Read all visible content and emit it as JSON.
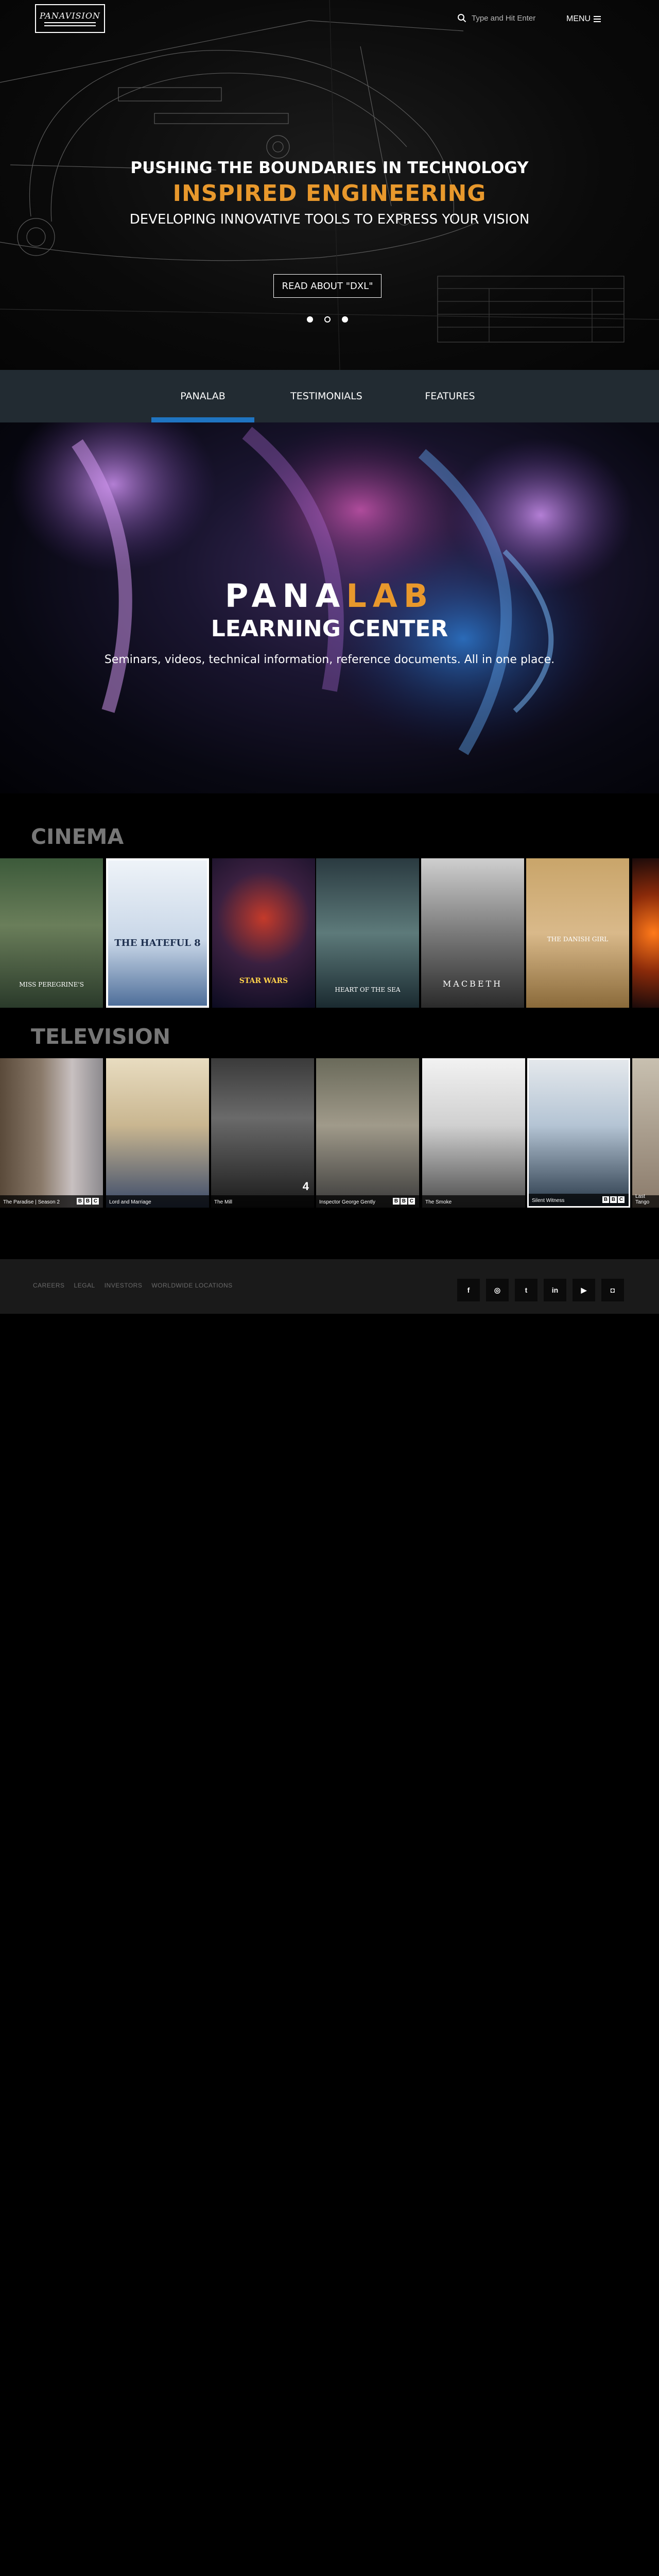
{
  "header": {
    "logo_text": "PANAVISION",
    "search": {
      "placeholder": "Type and Hit Enter",
      "icon": "search-icon"
    },
    "menu_label": "MENU",
    "menu_icon": "hamburger-icon"
  },
  "hero": {
    "kicker": "PUSHING THE BOUNDARIES IN TECHNOLOGY",
    "title": "INSPIRED ENGINEERING",
    "subtitle": "DEVELOPING INNOVATIVE TOOLS TO EXPRESS YOUR VISION",
    "cta": "READ ABOUT \"DXL\"",
    "slides": 3,
    "active_slide": 2
  },
  "tabs": {
    "items": [
      {
        "label": "PANALAB",
        "active": true
      },
      {
        "label": "TESTIMONIALS",
        "active": false
      },
      {
        "label": "FEATURES",
        "active": false
      }
    ]
  },
  "banner": {
    "brand_a": "PANA",
    "brand_b": "LAB",
    "title": "LEARNING CENTER",
    "description": "Seminars, videos, technical information, reference documents. All in one place."
  },
  "cinema": {
    "heading": "CINEMA",
    "posters": [
      {
        "title": "Miss Peregrine's Home for Peculiar Children",
        "poster_text": "MISS PEREGRINE'S"
      },
      {
        "title": "The Hateful 8",
        "poster_text": "THE HATEFUL 8"
      },
      {
        "title": "Star Wars: The Force Awakens",
        "poster_text": "STAR WARS"
      },
      {
        "title": "In the Heart of the Sea",
        "poster_text": "HEART OF THE SEA"
      },
      {
        "title": "Macbeth",
        "poster_text": "MACBETH"
      },
      {
        "title": "The Danish Girl",
        "poster_text": "THE DANISH GIRL"
      },
      {
        "title": "",
        "poster_text": ""
      }
    ]
  },
  "television": {
    "heading": "TELEVISION",
    "shows": [
      {
        "title": "The Paradise | Season 2",
        "network": "BBC"
      },
      {
        "title": "Lord and Marriage",
        "network": ""
      },
      {
        "title": "The Mill",
        "network": "4"
      },
      {
        "title": "Inspector George Gently",
        "network": "BBC"
      },
      {
        "title": "The Smoke",
        "network": ""
      },
      {
        "title": "Silent Witness",
        "network": "BBC"
      },
      {
        "title": "Last Tango",
        "network": ""
      }
    ]
  },
  "footer": {
    "links": [
      "CAREERS",
      "LEGAL",
      "INVESTORS",
      "WORLDWIDE LOCATIONS"
    ],
    "socials": [
      {
        "icon": "facebook-icon",
        "glyph": "f"
      },
      {
        "icon": "instagram-icon",
        "glyph": "◎"
      },
      {
        "icon": "twitter-icon",
        "glyph": "t"
      },
      {
        "icon": "linkedin-icon",
        "glyph": "in"
      },
      {
        "icon": "youtube-icon",
        "glyph": "▶"
      },
      {
        "icon": "instagram-alt-icon",
        "glyph": "◘"
      }
    ]
  },
  "colors": {
    "accent": "#e8982c",
    "tab_bar": "#222b32",
    "tab_active": "#1f74c1",
    "footer": "#1a1a1a"
  }
}
